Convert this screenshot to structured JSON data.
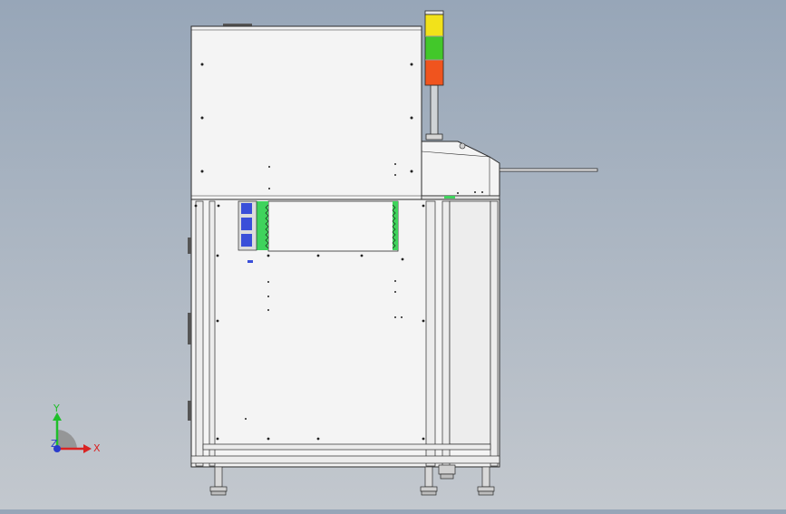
{
  "viewport": {
    "background_top": "#97a6b8",
    "background_bottom": "#c3c8ce"
  },
  "model": {
    "body_fill": "#f4f4f4",
    "edge_color": "#2a2a2a",
    "light_colors": {
      "top": "#f2e21a",
      "middle": "#42c82a",
      "bottom": "#f0541e"
    },
    "green_rail_color": "#3fd35c",
    "connector_color": "#3a4fd9"
  },
  "triad": {
    "y_label": "Y",
    "x_label": "X",
    "z_label": "Z",
    "y_color": "#1fbf2a",
    "x_color": "#d92323",
    "z_color": "#2a3ccc"
  }
}
